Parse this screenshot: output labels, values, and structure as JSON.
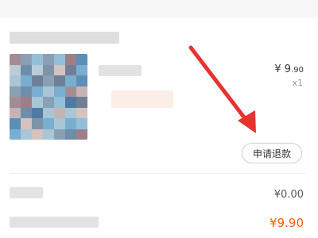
{
  "order": {
    "item": {
      "price": "¥ 9",
      "price_decimal": ".90",
      "quantity": "x1"
    },
    "refund_button": "申请退款",
    "summary": {
      "row1_amount": "¥0.00",
      "row2_amount": "¥9.90"
    }
  },
  "colors": {
    "accent_orange": "#ff5c00",
    "arrow_red": "#e83230"
  }
}
